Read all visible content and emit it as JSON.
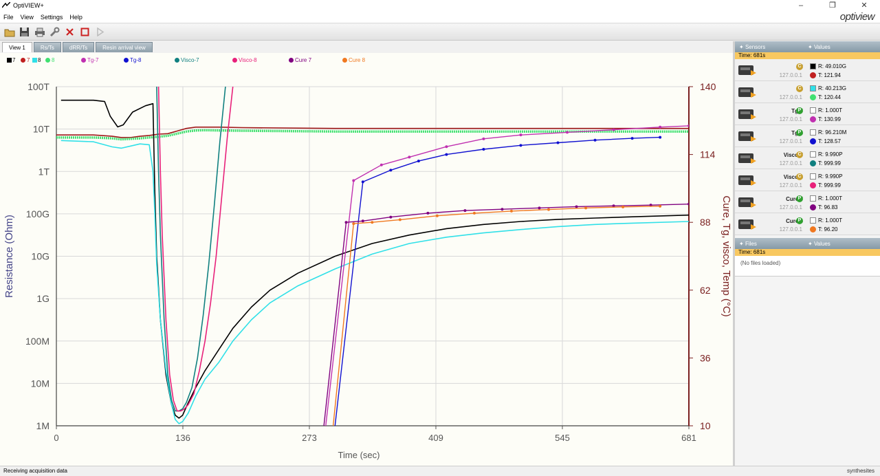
{
  "window": {
    "title": "OptiVIEW+",
    "logo": "optiview"
  },
  "menu": [
    "File",
    "View",
    "Settings",
    "Help"
  ],
  "toolbar": [
    {
      "name": "open-folder-icon",
      "color": "#c8a040"
    },
    {
      "name": "save-icon",
      "color": "#333"
    },
    {
      "name": "print-icon",
      "color": "#555"
    },
    {
      "name": "wrench-icon",
      "color": "#777"
    },
    {
      "name": "close-x-icon",
      "color": "#cc2222"
    },
    {
      "name": "stop-icon",
      "color": "#cc2222"
    },
    {
      "name": "play-icon",
      "color": "#bbbbbb"
    }
  ],
  "tabs": [
    "View 1",
    "Rs/Ts",
    "dRR/Ts",
    "Resin arrival view"
  ],
  "legend": [
    {
      "label": "7",
      "color": "#000000",
      "kind": "sq"
    },
    {
      "label": "7",
      "color": "#c02020",
      "kind": "dot"
    },
    {
      "label": "8",
      "color": "#30e0e8",
      "kind": "sq"
    },
    {
      "label": "8",
      "color": "#40e070",
      "kind": "dot"
    },
    {
      "label": "Tg-7",
      "color": "#c030b0",
      "kind": "dot"
    },
    {
      "label": "Tg-8",
      "color": "#1010d0",
      "kind": "dot"
    },
    {
      "label": "Visco-7",
      "color": "#108080",
      "kind": "dot"
    },
    {
      "label": "Visco-8",
      "color": "#e8207a",
      "kind": "dot"
    },
    {
      "label": "Cure 7",
      "color": "#800080",
      "kind": "dot"
    },
    {
      "label": "Cure 8",
      "color": "#f07820",
      "kind": "dot"
    }
  ],
  "chart_data": {
    "type": "line",
    "xlabel": "Time (sec)",
    "ylabel": "Resistance (Ohm)",
    "y2label": "Cure, Tg, visco, Temp (°C)",
    "xlim": [
      0,
      681
    ],
    "x_ticks": [
      "0",
      "136",
      "273",
      "409",
      "545",
      "681"
    ],
    "ylim_log10": [
      6,
      14
    ],
    "y_ticks": [
      "1M",
      "10M",
      "100M",
      "1G",
      "10G",
      "100G",
      "1T",
      "10T",
      "100T"
    ],
    "y2lim": [
      10,
      140
    ],
    "y2_ticks": [
      "10",
      "36",
      "62",
      "88",
      "114",
      "140"
    ],
    "grid": true,
    "resistance_series": [
      {
        "name": "7",
        "color": "#000000",
        "axis": "left_log",
        "x": [
          5,
          40,
          52,
          58,
          66,
          72,
          82,
          96,
          104,
          106,
          108,
          112,
          118,
          124,
          128,
          132,
          136,
          141,
          150,
          160,
          175,
          190,
          210,
          230,
          260,
          300,
          340,
          380,
          420,
          460,
          500,
          540,
          580,
          620,
          681
        ],
        "y": [
          13.68,
          13.68,
          13.65,
          13.3,
          13.05,
          13.1,
          13.4,
          13.55,
          13.6,
          11.5,
          10,
          8.5,
          7.2,
          6.5,
          6.25,
          6.18,
          6.25,
          6.5,
          6.9,
          7.3,
          7.8,
          8.3,
          8.8,
          9.2,
          9.6,
          10,
          10.3,
          10.5,
          10.65,
          10.75,
          10.82,
          10.87,
          10.9,
          10.93,
          10.97
        ]
      },
      {
        "name": "8",
        "color": "#30e0e8",
        "axis": "left_log",
        "x": [
          5,
          40,
          60,
          70,
          80,
          90,
          100,
          104,
          106,
          108,
          112,
          118,
          124,
          128,
          132,
          136,
          142,
          150,
          160,
          175,
          190,
          210,
          230,
          260,
          300,
          340,
          380,
          420,
          460,
          500,
          540,
          580,
          620,
          681
        ],
        "y": [
          12.73,
          12.7,
          12.58,
          12.55,
          12.6,
          12.65,
          12.63,
          12.0,
          11.0,
          9.8,
          8.5,
          7.3,
          6.5,
          6.15,
          6.05,
          6.1,
          6.3,
          6.7,
          7.1,
          7.5,
          8.0,
          8.5,
          8.9,
          9.3,
          9.7,
          10.05,
          10.3,
          10.45,
          10.55,
          10.63,
          10.7,
          10.75,
          10.78,
          10.82
        ]
      }
    ],
    "temperature_series": [
      {
        "name": "7",
        "color": "#a01818",
        "axis": "right",
        "x": [
          0,
          40,
          60,
          70,
          80,
          90,
          100,
          110,
          120,
          130,
          140,
          150,
          160,
          175,
          200,
          300,
          400,
          500,
          600,
          681
        ],
        "y": [
          121.5,
          121.5,
          121,
          120.5,
          120.5,
          121,
          121.3,
          121.8,
          122,
          123,
          124,
          124.5,
          124.5,
          124.5,
          124.3,
          124,
          124,
          124,
          124,
          124
        ]
      },
      {
        "name": "8",
        "color": "#40e070",
        "axis": "right",
        "x": [
          0,
          40,
          60,
          70,
          80,
          90,
          100,
          110,
          120,
          130,
          140,
          150,
          160,
          175,
          200,
          300,
          400,
          500,
          600,
          681
        ],
        "y": [
          120.5,
          120.5,
          120.2,
          119.8,
          120,
          120.2,
          120.5,
          120.8,
          121.2,
          122,
          122.8,
          123.2,
          123.3,
          123.2,
          123.1,
          122.8,
          122.8,
          122.8,
          122.8,
          122.8
        ]
      }
    ],
    "cure_tg_series": [
      {
        "name": "Tg-7",
        "color": "#c030b0",
        "x": [
          290,
          320,
          350,
          380,
          420,
          460,
          500,
          550,
          600,
          650,
          681
        ],
        "y": [
          10,
          104,
          110,
          113,
          117,
          120,
          121.5,
          122.5,
          123.5,
          124.5,
          125
        ]
      },
      {
        "name": "Tg-8",
        "color": "#1010d0",
        "x": [
          300,
          330,
          360,
          390,
          420,
          460,
          500,
          540,
          580,
          620,
          650
        ],
        "y": [
          10,
          103.5,
          108,
          111.5,
          114,
          116,
          117.5,
          118.5,
          119.5,
          120.2,
          120.6
        ]
      },
      {
        "name": "Cure 7",
        "color": "#800080",
        "x": [
          288,
          312,
          330,
          360,
          400,
          440,
          480,
          520,
          560,
          600,
          640,
          681
        ],
        "y": [
          10,
          88,
          88.5,
          90,
          91.5,
          92.5,
          93,
          93.5,
          94,
          94.3,
          94.6,
          95
        ]
      },
      {
        "name": "Cure 8",
        "color": "#f07820",
        "x": [
          298,
          320,
          340,
          370,
          410,
          450,
          490,
          530,
          570,
          610,
          650
        ],
        "y": [
          10,
          87.5,
          88,
          89,
          90.5,
          91.5,
          92.3,
          92.9,
          93.5,
          93.9,
          94.2
        ]
      }
    ],
    "visco_series": [
      {
        "name": "Visco-7",
        "color": "#108080",
        "axis": "left_log",
        "x": [
          108,
          110,
          112,
          116,
          120,
          124,
          128,
          132,
          136,
          140,
          146,
          152,
          158,
          164,
          170,
          176,
          182,
          188
        ],
        "y": [
          14,
          12,
          10.5,
          8.5,
          7.2,
          6.6,
          6.35,
          6.35,
          6.4,
          6.55,
          6.9,
          7.6,
          8.6,
          9.8,
          11.2,
          12.7,
          14.0,
          14.6
        ]
      },
      {
        "name": "Visco-8",
        "color": "#e8207a",
        "axis": "left_log",
        "x": [
          110,
          112,
          114,
          118,
          122,
          126,
          130,
          134,
          138,
          142,
          148,
          154,
          160,
          166,
          172,
          178,
          184,
          190,
          196
        ],
        "y": [
          14,
          12,
          10.5,
          8.5,
          7.2,
          6.6,
          6.35,
          6.35,
          6.4,
          6.5,
          6.75,
          7.3,
          8.0,
          8.9,
          10.0,
          11.4,
          12.8,
          14.0,
          14.6
        ]
      }
    ]
  },
  "panel": {
    "sensors_header": "Sensors",
    "values_header": "Values",
    "time": "Time: 681s",
    "sensors": [
      {
        "name": "7",
        "ip": "127.0.0.1",
        "badge": "C",
        "badge_color": "#c8a030",
        "r_color": "#000000",
        "r": "R: 49.010G",
        "t_color": "#c02020",
        "t": "T: 121.94"
      },
      {
        "name": "8",
        "ip": "127.0.0.1",
        "badge": "C",
        "badge_color": "#c8a030",
        "r_color": "#30e0e8",
        "r": "R: 40.213G",
        "t_color": "#40e070",
        "t": "T: 120.44"
      },
      {
        "name": "Tg-7",
        "ip": "127.0.0.1",
        "badge": "P",
        "badge_color": "#30a030",
        "r_color": "#ffffff",
        "r": "R: 1.000T",
        "t_color": "#c030b0",
        "t": "T: 130.99"
      },
      {
        "name": "Tg-8",
        "ip": "127.0.0.1",
        "badge": "P",
        "badge_color": "#30a030",
        "r_color": "#ffffff",
        "r": "R: 96.210M",
        "t_color": "#1010d0",
        "t": "T: 128.57"
      },
      {
        "name": "Visco-7",
        "ip": "127.0.0.1",
        "badge": "C",
        "badge_color": "#c8a030",
        "r_color": "#ffffff",
        "r": "R: 9.990P",
        "t_color": "#108080",
        "t": "T: 999.99"
      },
      {
        "name": "Visco-8",
        "ip": "127.0.0.1",
        "badge": "C",
        "badge_color": "#c8a030",
        "r_color": "#ffffff",
        "r": "R: 9.990P",
        "t_color": "#e8207a",
        "t": "T: 999.99"
      },
      {
        "name": "Cure 7",
        "ip": "127.0.0.1",
        "badge": "P",
        "badge_color": "#30a030",
        "r_color": "#ffffff",
        "r": "R: 1.000T",
        "t_color": "#800080",
        "t": "T: 96.83"
      },
      {
        "name": "Cure 8",
        "ip": "127.0.0.1",
        "badge": "P",
        "badge_color": "#30a030",
        "r_color": "#ffffff",
        "r": "R: 1.000T",
        "t_color": "#f07820",
        "t": "T: 96.20"
      }
    ],
    "files_header": "Files",
    "files_values_header": "Values",
    "files_time": "Time: 681s",
    "no_files": "(No files loaded)"
  },
  "status": {
    "text": "Receiving acquisition data",
    "brand": "synthesites"
  }
}
